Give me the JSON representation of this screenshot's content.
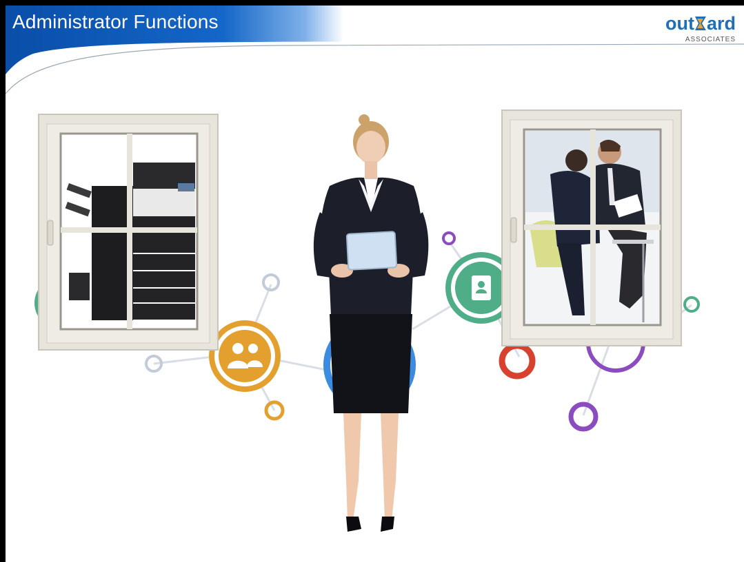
{
  "header": {
    "title": "Administrator  Functions"
  },
  "logo": {
    "word_prefix": "out",
    "word_suffix": "ard",
    "sub": "ASSOCIATES"
  },
  "colors": {
    "header_blue": "#0a55b8",
    "logo_blue": "#1e6fb5",
    "ring_green": "#4fae88",
    "ring_orange": "#e3a02f",
    "ring_blue": "#3b8be0",
    "ring_red": "#d9412f",
    "ring_purple": "#8a4cbf",
    "ring_gray": "#b8c2d2"
  },
  "icons": [
    "people-icon",
    "contacts-book-icon",
    "printer-icon"
  ]
}
